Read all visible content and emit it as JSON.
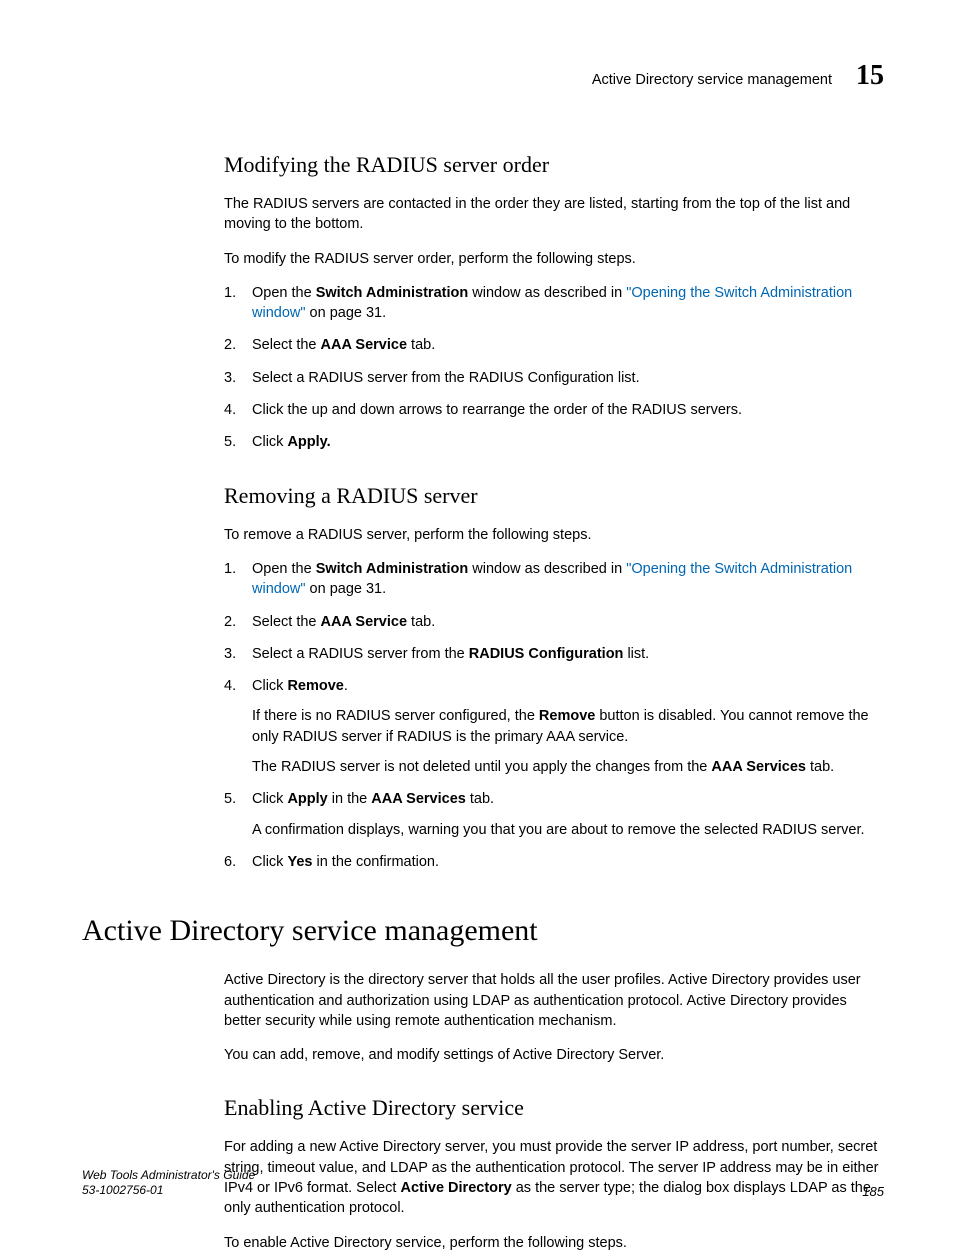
{
  "header": {
    "title": "Active Directory service management",
    "chapter": "15"
  },
  "section1": {
    "heading": "Modifying the RADIUS server order",
    "intro": "The RADIUS servers are contacted in the order they are listed, starting from the top of the list and moving to the bottom.",
    "lead": "To modify the RADIUS server order, perform the following steps.",
    "steps": {
      "s1a": "Open the ",
      "s1b": "Switch Administration",
      "s1c": " window as described in ",
      "s1link": "\"Opening the Switch Administration window\"",
      "s1d": " on page 31.",
      "s2a": "Select the ",
      "s2b": "AAA Service",
      "s2c": " tab.",
      "s3": "Select a RADIUS server from the RADIUS Configuration list.",
      "s4": "Click the up and down arrows to rearrange the order of the RADIUS servers.",
      "s5a": "Click ",
      "s5b": "Apply."
    }
  },
  "section2": {
    "heading": "Removing a RADIUS server",
    "lead": "To remove a RADIUS server, perform the following steps.",
    "steps": {
      "s1a": "Open the ",
      "s1b": "Switch Administration",
      "s1c": " window as described in ",
      "s1link": "\"Opening the Switch Administration window\"",
      "s1d": " on page 31.",
      "s2a": "Select the ",
      "s2b": "AAA Service",
      "s2c": " tab.",
      "s3a": "Select a RADIUS server from the ",
      "s3b": "RADIUS Configuration",
      "s3c": " list.",
      "s4a": "Click ",
      "s4b": "Remove",
      "s4c": ".",
      "s4p1a": "If there is no RADIUS server configured, the ",
      "s4p1b": "Remove",
      "s4p1c": " button is disabled. You cannot remove the only RADIUS server if RADIUS is the primary AAA service.",
      "s4p2a": "The RADIUS server is not deleted until you apply the changes from the ",
      "s4p2b": "AAA Services",
      "s4p2c": " tab.",
      "s5a": "Click ",
      "s5b": "Apply",
      "s5c": " in the ",
      "s5d": "AAA Services",
      "s5e": " tab.",
      "s5p1": "A confirmation displays, warning you that you are about to remove the selected RADIUS server.",
      "s6a": "Click ",
      "s6b": "Yes",
      "s6c": " in the confirmation."
    }
  },
  "section3": {
    "heading": "Active Directory service management",
    "p1": "Active Directory is the directory server that holds all the user profiles. Active Directory provides user authentication and authorization using LDAP as authentication protocol. Active Directory provides better security while using remote authentication mechanism.",
    "p2": "You can add, remove, and modify settings of Active Directory Server."
  },
  "section4": {
    "heading": "Enabling Active Directory service",
    "p1a": "For adding a new Active Directory server, you must provide the server IP address, port number, secret string, timeout value, and LDAP as the authentication protocol. The server IP address may be in either IPv4 or IPv6 format. Select ",
    "p1b": "Active Directory",
    "p1c": " as the server type; the dialog box displays LDAP as the only authentication protocol.",
    "p2": "To enable Active Directory service, perform the following steps."
  },
  "footer": {
    "guide": "Web Tools Administrator's Guide",
    "docnum": "53-1002756-01",
    "page": "185"
  }
}
